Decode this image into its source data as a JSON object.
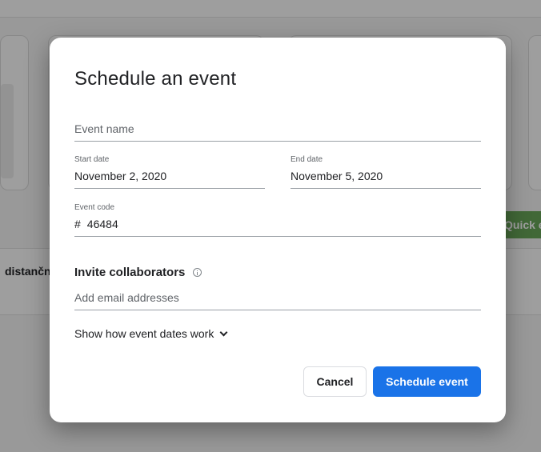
{
  "background": {
    "partial_text_left": "distanční",
    "partial_button_right": "Quick e",
    "accent_green": "#6aa85a"
  },
  "dialog": {
    "title": "Schedule an event",
    "event_name": {
      "placeholder": "Event name",
      "value": ""
    },
    "start_date": {
      "label": "Start date",
      "value": "November 2, 2020"
    },
    "end_date": {
      "label": "End date",
      "value": "November 5, 2020"
    },
    "event_code": {
      "label": "Event code",
      "prefix": "#",
      "value": "46484"
    },
    "invite": {
      "title": "Invite collaborators",
      "info_icon": "info-icon",
      "placeholder": "Add email addresses"
    },
    "show_dates_link": "Show how event dates work",
    "chevron_icon": "chevron-down-icon",
    "buttons": {
      "cancel": "Cancel",
      "primary": "Schedule event"
    },
    "primary_color": "#1a73e8"
  }
}
